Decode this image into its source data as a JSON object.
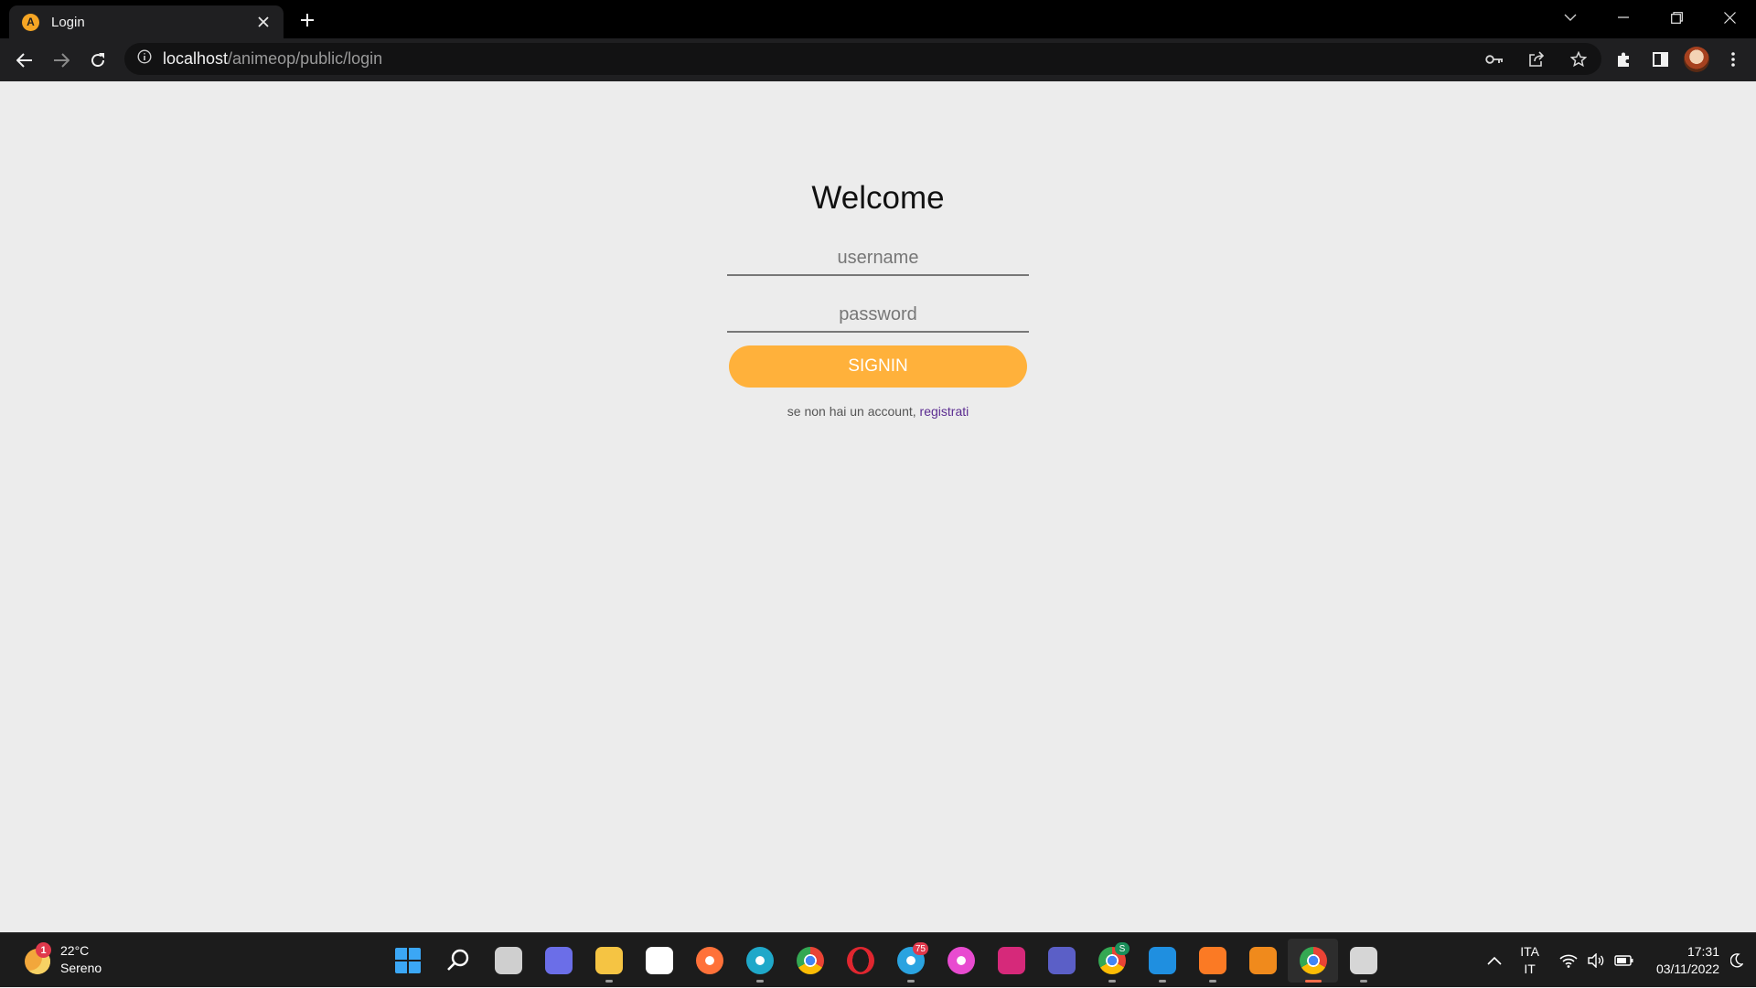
{
  "browser": {
    "tab_title": "Login",
    "favicon_letter": "A",
    "url_host": "localhost",
    "url_path": "/animeop/public/login"
  },
  "login": {
    "heading": "Welcome",
    "username_placeholder": "username",
    "password_placeholder": "password",
    "signin_label": "SIGNIN",
    "signup_text": "se non hai un account, ",
    "signup_link": "registrati",
    "accent_color": "#ffb13b",
    "link_color": "#5b2c91"
  },
  "taskbar": {
    "weather_temp": "22°C",
    "weather_desc": "Sereno",
    "weather_badge": "1",
    "apps": [
      {
        "name": "start-icon",
        "color": "#3ba7f5"
      },
      {
        "name": "search-icon",
        "color": "#ffffff"
      },
      {
        "name": "task-view-icon",
        "color": "#cfcfcf"
      },
      {
        "name": "chat-icon",
        "color": "#6b6ee8"
      },
      {
        "name": "file-explorer-icon",
        "color": "#f5c443"
      },
      {
        "name": "store-icon",
        "color": "#ffffff"
      },
      {
        "name": "firefox-icon",
        "color": "#ff7139"
      },
      {
        "name": "edge-icon",
        "color": "#1fa8c9"
      },
      {
        "name": "chrome-icon",
        "color": "#34a853"
      },
      {
        "name": "opera-icon",
        "color": "#e0262f"
      },
      {
        "name": "telegram-icon",
        "color": "#2aa3e0",
        "badge": "75"
      },
      {
        "name": "tinder-icon",
        "color": "#e84bd0"
      },
      {
        "name": "instagram-icon",
        "color": "#d6297a"
      },
      {
        "name": "teams-icon",
        "color": "#5b5fc7"
      },
      {
        "name": "chrome-profile-icon",
        "color": "#34a853",
        "badge": "S"
      },
      {
        "name": "vscode-icon",
        "color": "#1f8fe0"
      },
      {
        "name": "xampp-icon",
        "color": "#fb7a24"
      },
      {
        "name": "vlc-icon",
        "color": "#f08a1c"
      },
      {
        "name": "chrome-active-icon",
        "color": "#ea4335"
      },
      {
        "name": "snipping-tool-icon",
        "color": "#d6d6d6"
      }
    ],
    "lang_top": "ITA",
    "lang_bottom": "IT",
    "time": "17:31",
    "date": "03/11/2022"
  }
}
